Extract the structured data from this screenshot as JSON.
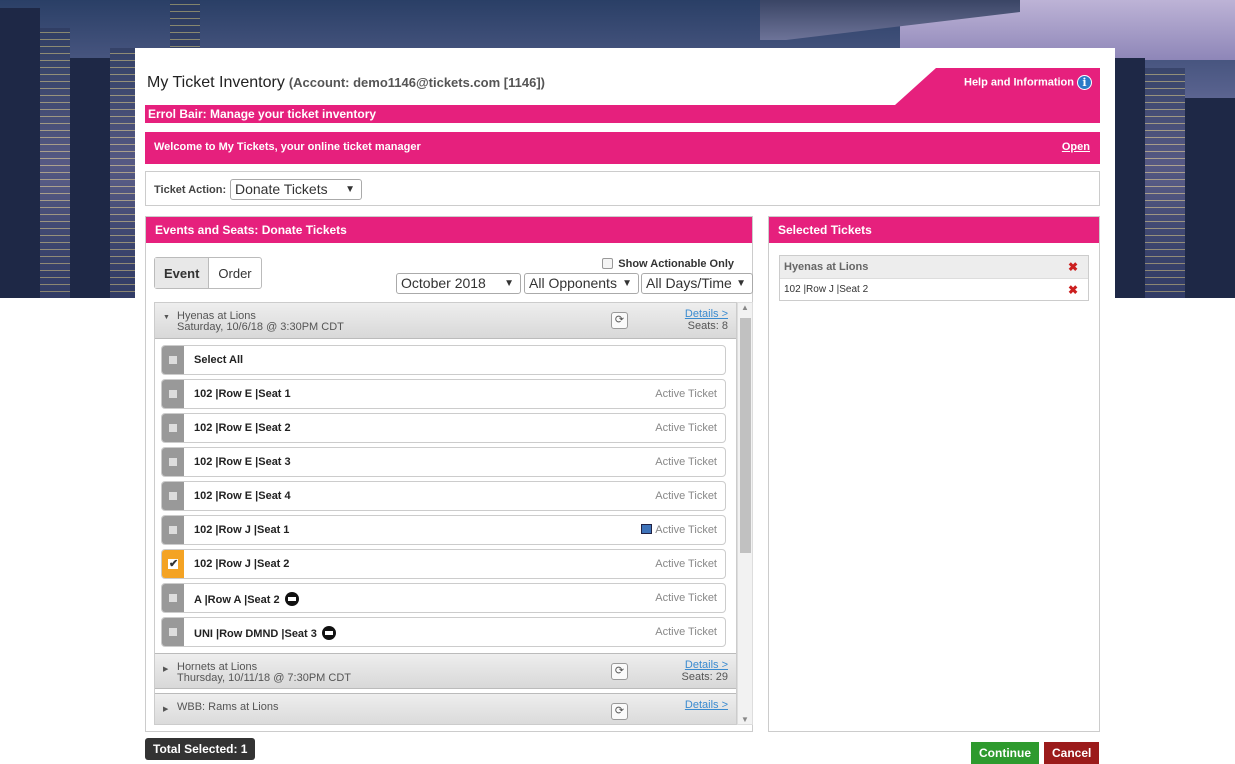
{
  "header": {
    "title": "My Ticket Inventory",
    "account": "(Account: demo1146@tickets.com [1146])",
    "help": "Help and Information",
    "subtitle": "Errol Bair: Manage your ticket inventory"
  },
  "welcome": {
    "text": "Welcome to My Tickets, your online ticket manager",
    "open": "Open"
  },
  "ticket_action": {
    "label": "Ticket Action:",
    "value": "Donate Tickets"
  },
  "events_panel": {
    "title": "Events and Seats: Donate Tickets",
    "toggle": [
      "Event",
      "Order"
    ],
    "show_actionable": "Show Actionable Only",
    "filters": {
      "month": "October 2018",
      "opponents": "All Opponents",
      "days": "All Days/Time"
    }
  },
  "events": [
    {
      "name": "Hyenas at Lions",
      "date": "Saturday, 10/6/18 @ 3:30PM CDT",
      "details": "Details >",
      "seats": "Seats: 8",
      "select_all": "Select All",
      "tickets": [
        {
          "label": "102 |Row E |Seat 1",
          "status": "Active Ticket"
        },
        {
          "label": "102 |Row E |Seat 2",
          "status": "Active Ticket"
        },
        {
          "label": "102 |Row E |Seat 3",
          "status": "Active Ticket"
        },
        {
          "label": "102 |Row E |Seat 4",
          "status": "Active Ticket"
        },
        {
          "label": "102 |Row J |Seat 1",
          "status": "Active Ticket"
        },
        {
          "label": "102 |Row J |Seat 2",
          "status": "Active Ticket"
        },
        {
          "label": "A |Row A |Seat 2",
          "status": "Active Ticket"
        },
        {
          "label": "UNI |Row DMND |Seat 3",
          "status": "Active Ticket"
        }
      ]
    },
    {
      "name": "Hornets at Lions",
      "date": "Thursday, 10/11/18 @ 7:30PM CDT",
      "details": "Details >",
      "seats": "Seats: 29"
    },
    {
      "name": "WBB: Rams at Lions",
      "details": "Details >"
    }
  ],
  "selected_panel": {
    "title": "Selected Tickets",
    "event": "Hyenas at Lions",
    "items": [
      "102 |Row J |Seat 2"
    ]
  },
  "footer": {
    "total": "Total Selected: 1",
    "continue": "Continue",
    "cancel": "Cancel"
  },
  "colors": {
    "accent": "#e6207d",
    "selected": "#f4a324",
    "continue": "#2e9a2e",
    "cancel": "#9b1b1b"
  }
}
